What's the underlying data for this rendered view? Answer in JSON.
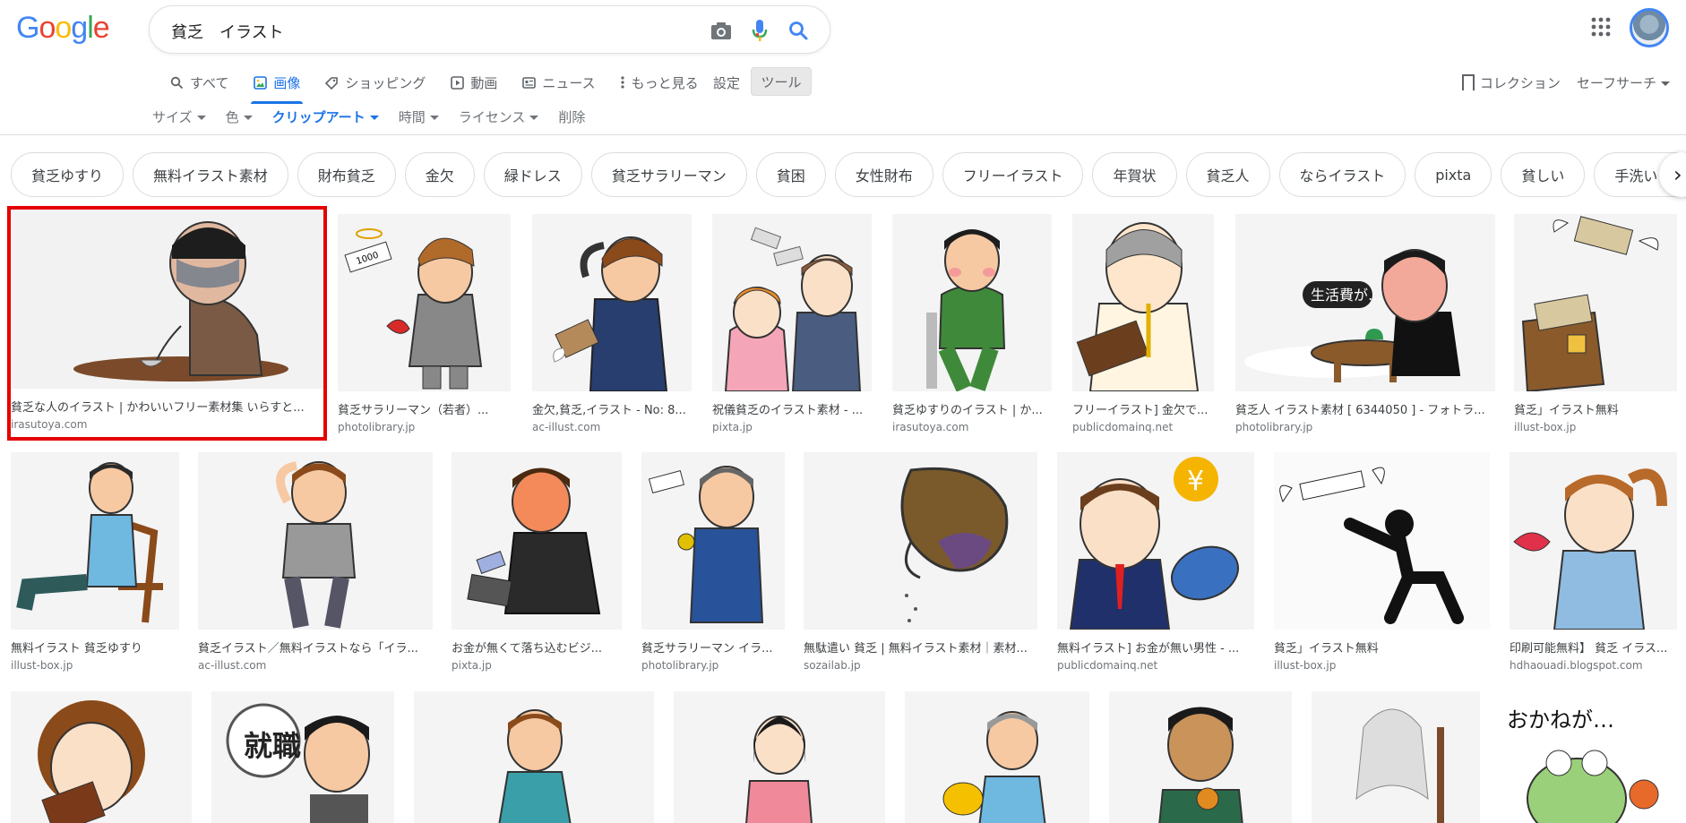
{
  "query": "貧乏　イラスト",
  "logo": [
    "G",
    "o",
    "o",
    "g",
    "l",
    "e"
  ],
  "colors": {
    "accent": "#1a73e8",
    "highlight": "#e50000",
    "logo": [
      "#4285f4",
      "#ea4335",
      "#fbbc05",
      "#4285f4",
      "#34a853",
      "#ea4335"
    ]
  },
  "tabs": [
    {
      "label": "すべて",
      "icon": "search-icon"
    },
    {
      "label": "画像",
      "icon": "image-icon",
      "active": true
    },
    {
      "label": "ショッピング",
      "icon": "tag-icon"
    },
    {
      "label": "動画",
      "icon": "video-icon"
    },
    {
      "label": "ニュース",
      "icon": "news-icon"
    },
    {
      "label": "もっと見る",
      "icon": "more-vert-icon"
    }
  ],
  "settings_label": "設定",
  "tools_label": "ツール",
  "right_links": {
    "collections": "コレクション",
    "safesearch": "セーフサーチ"
  },
  "filters": [
    {
      "label": "サイズ"
    },
    {
      "label": "色"
    },
    {
      "label": "クリップアート",
      "selected": true
    },
    {
      "label": "時間"
    },
    {
      "label": "ライセンス"
    },
    {
      "label": "削除"
    }
  ],
  "chips": [
    "貧乏ゆすり",
    "無料イラスト素材",
    "財布貧乏",
    "金欠",
    "緑ドレス",
    "貧乏サラリーマン",
    "貧困",
    "女性財布",
    "フリーイラスト",
    "年賀状",
    "貧乏人",
    "ならイラスト",
    "pixta",
    "貧しい",
    "手洗いうがい"
  ],
  "results": [
    {
      "title": "貧乏な人のイラスト | かわいいフリー素材集 いらすと...",
      "source": "irasutoya.com"
    },
    {
      "title": "貧乏サラリーマン（若者）...",
      "source": "photolibrary.jp"
    },
    {
      "title": "金欠,貧乏,イラスト - No: 8...",
      "source": "ac-illust.com"
    },
    {
      "title": "祝儀貧乏のイラスト素材 - ...",
      "source": "pixta.jp"
    },
    {
      "title": "貧乏ゆすりのイラスト | か...",
      "source": "irasutoya.com"
    },
    {
      "title": "フリーイラスト] 金欠で...",
      "source": "publicdomainq.net"
    },
    {
      "title": "貧乏人 イラスト素材 [ 6344050 ] - フォトラ...",
      "source": "photolibrary.jp"
    },
    {
      "title": "貧乏」イラスト無料",
      "source": "illust-box.jp"
    },
    {
      "title": "無料イラスト 貧乏ゆすり",
      "source": "illust-box.jp"
    },
    {
      "title": "貧乏イラスト／無料イラストなら「イラ...",
      "source": "ac-illust.com"
    },
    {
      "title": "お金が無くて落ち込むビジ...",
      "source": "pixta.jp"
    },
    {
      "title": "貧乏サラリーマン イラ...",
      "source": "photolibrary.jp"
    },
    {
      "title": "無駄遣い 貧乏 | 無料イラスト素材｜素材...",
      "source": "sozailab.jp"
    },
    {
      "title": "無料イラスト] お金が無い男性 - ...",
      "source": "publicdomainq.net"
    },
    {
      "title": "貧乏」イラスト無料",
      "source": "illust-box.jp"
    },
    {
      "title": "印刷可能無料】 貧乏 イラス...",
      "source": "hdhaouadi.blogspot.com"
    }
  ],
  "thumb_text": {
    "money_bill": "1000",
    "speech_bubble": "生活費が…",
    "yen_sign": "¥",
    "job_sign": "就職",
    "okane_text": "おかねが…"
  }
}
